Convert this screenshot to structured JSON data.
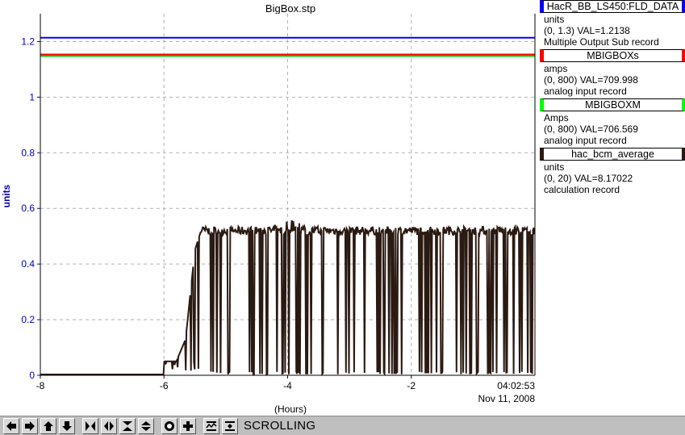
{
  "chart_data": {
    "type": "line",
    "title": "BigBox.stp",
    "xlabel": "(Hours)",
    "ylabel": "units",
    "xlim": [
      -8,
      0
    ],
    "ylim": [
      0,
      1.3
    ],
    "x_ticks": [
      "-8",
      "-6",
      "-4",
      "-2"
    ],
    "x_end_label": [
      "04:02:53",
      "Nov 11, 2008"
    ],
    "y_ticks": [
      "0",
      "0.2",
      "0.4",
      "0.6",
      "0.8",
      "1",
      "1.2"
    ],
    "y_tick_values": [
      0,
      0.2,
      0.4,
      0.6,
      0.8,
      1.0,
      1.2
    ],
    "grid": true,
    "series": [
      {
        "name": "HacR_BB_LS450:FLD_DATA",
        "color": "#0000ff",
        "style": "constant",
        "y": 1.2138
      },
      {
        "name": "MBIGBOXs",
        "color": "#ff0000",
        "style": "constant",
        "y": 1.1535
      },
      {
        "name": "MBIGBOXM",
        "color": "#00cc00",
        "style": "constant",
        "y": 1.148
      },
      {
        "name": "hac_bcm_average",
        "color": "#2b1a12",
        "style": "noisy",
        "baseline": 0.003,
        "ramp": [
          [
            -6.0,
            0.05
          ],
          [
            -5.8,
            0.05
          ],
          [
            -5.65,
            0.13
          ],
          [
            -5.5,
            0.45
          ],
          [
            -5.4,
            0.52
          ]
        ],
        "plateau": 0.52,
        "spike_start": -5.55,
        "x": [
          -8,
          -6,
          -5.9,
          -5.8,
          -5.7,
          -5.6,
          -5.5,
          -5.45,
          -5.4,
          -5,
          -4.5,
          -4,
          -3.5,
          -3,
          -2.5,
          -2,
          -1.5,
          -1,
          -0.5,
          0
        ],
        "y": [
          0.003,
          0.003,
          0.05,
          0.05,
          0.06,
          0.13,
          0.4,
          0.52,
          0.52,
          0.52,
          0.52,
          0.54,
          0.53,
          0.52,
          0.52,
          0.53,
          0.52,
          0.52,
          0.52,
          0.52
        ]
      }
    ]
  },
  "legend": [
    {
      "name": "HacR_BB_LS450:FLD_DATA",
      "color": "#0000ff",
      "units": "units",
      "range": "(0, 1.3) VAL=1.2138",
      "record": "Multiple Output Sub record"
    },
    {
      "name": "MBIGBOXs",
      "color": "#ff0000",
      "units": "amps",
      "range": "(0, 800) VAL=709.998",
      "record": "analog input record"
    },
    {
      "name": "MBIGBOXM",
      "color": "#00ff00",
      "units": "Amps",
      "range": "(0, 800) VAL=706.569",
      "record": "analog input record"
    },
    {
      "name": "hac_bcm_average",
      "color": "#2b1a12",
      "units": "units",
      "range": "(0, 20) VAL=8.17022",
      "record": "calculation record"
    }
  ],
  "toolbar": {
    "buttons": [
      {
        "icon": "arrow-left-icon",
        "name": "pan-left-button"
      },
      {
        "icon": "arrow-right-icon",
        "name": "pan-right-button"
      },
      {
        "icon": "arrow-up-icon",
        "name": "pan-up-button"
      },
      {
        "icon": "arrow-down-icon",
        "name": "pan-down-button"
      },
      {
        "icon": "zoom-in-x-icon",
        "name": "zoom-in-x-button"
      },
      {
        "icon": "zoom-out-x-icon",
        "name": "zoom-out-x-button"
      },
      {
        "icon": "zoom-in-y-icon",
        "name": "zoom-in-y-button"
      },
      {
        "icon": "zoom-out-y-icon",
        "name": "zoom-out-y-button"
      },
      {
        "icon": "auto-scale-icon",
        "name": "auto-scale-button"
      },
      {
        "icon": "plus-icon",
        "name": "add-button"
      },
      {
        "icon": "stagger-icon",
        "name": "stagger-button"
      },
      {
        "icon": "mouse-mode-icon",
        "name": "mouse-mode-button"
      }
    ],
    "status": "SCROLLING"
  }
}
